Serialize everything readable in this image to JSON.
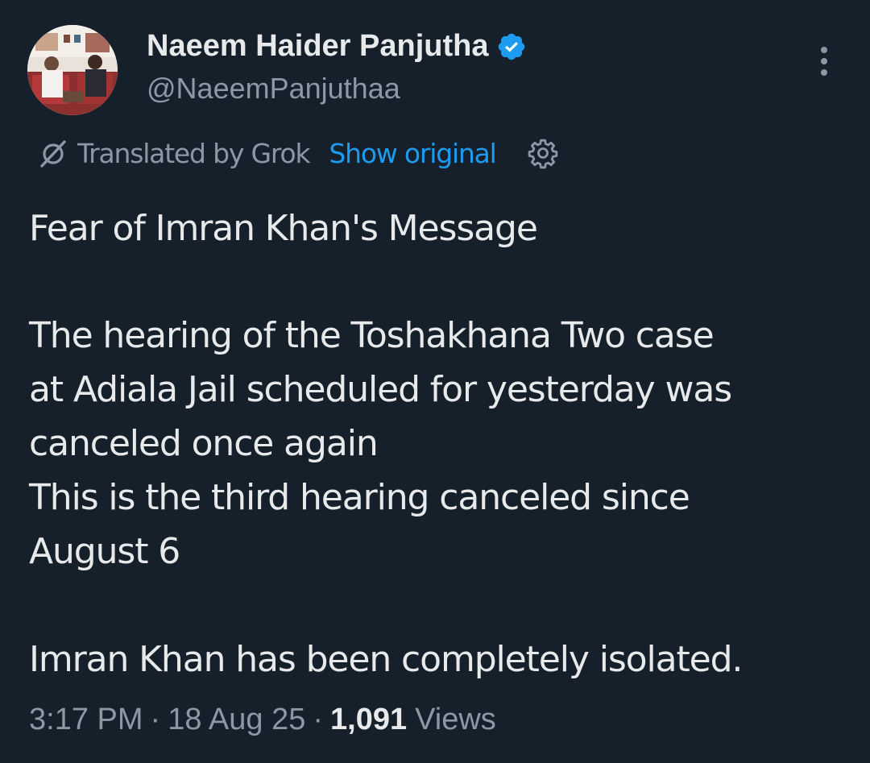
{
  "author": {
    "name": "Naeem Haider Panjutha",
    "handle": "@NaeemPanjuthaa",
    "verified": true
  },
  "translation": {
    "label": "Translated by Grok",
    "show_original": "Show original"
  },
  "post": {
    "title": "Fear of Imran Khan's Message",
    "lines": [
      "The hearing of the Toshakhana Two case",
      "at Adiala Jail scheduled for yesterday was",
      "canceled once again",
      "This is the third hearing canceled since",
      "August 6"
    ],
    "closing": "Imran Khan has been completely isolated."
  },
  "meta": {
    "time": "3:17 PM",
    "separator": "·",
    "date": "18 Aug 25",
    "views_count": "1,091",
    "views_label": "Views"
  },
  "colors": {
    "background": "#15202b",
    "text": "#e7e9ea",
    "secondary": "#8b98a5",
    "accent": "#1d9bf0"
  },
  "icons": {
    "verified": "verified-badge-icon",
    "more": "more-options-icon",
    "grok": "grok-icon",
    "settings": "gear-icon"
  }
}
